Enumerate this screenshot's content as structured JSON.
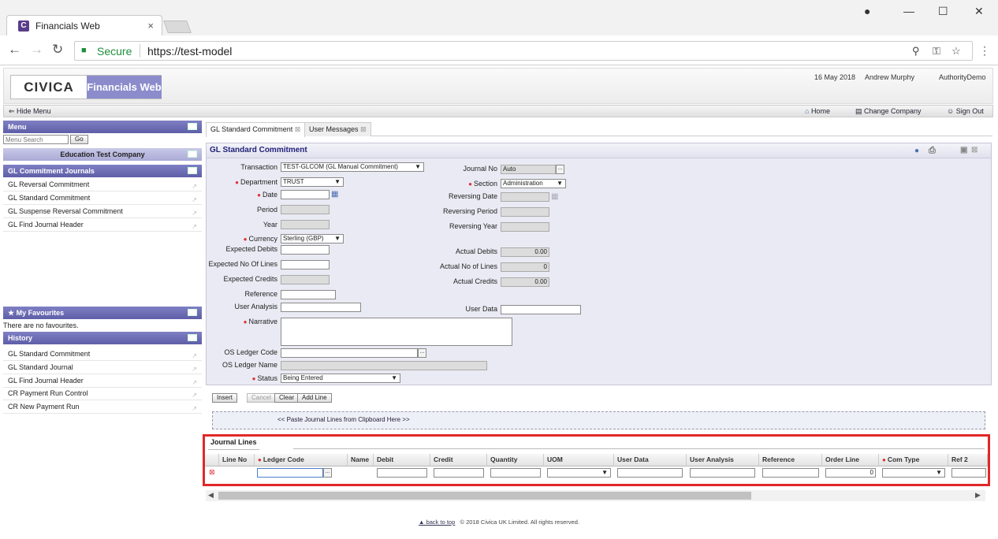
{
  "browser": {
    "tab_title": "Financials Web",
    "tab_close": "×",
    "secure": "Secure",
    "url": "https://test-model"
  },
  "header": {
    "brand": "CIVICA",
    "app_name": "Financials Web",
    "date": "16 May 2018",
    "user": "Andrew Murphy",
    "org": "AuthorityDemo"
  },
  "menubar": {
    "hide_menu": "Hide Menu",
    "home": "Home",
    "change_company": "Change Company",
    "sign_out": "Sign Out"
  },
  "sidebar": {
    "menu_title": "Menu",
    "search_placeholder": "Menu Search",
    "go": "Go",
    "company": "Education Test Company",
    "section_title": "GL Commitment Journals",
    "items": [
      {
        "label": "GL Reversal Commitment"
      },
      {
        "label": "GL Standard Commitment"
      },
      {
        "label": "GL Suspense Reversal Commitment"
      },
      {
        "label": "GL Find Journal Header"
      }
    ],
    "favourites_title": "My Favourites",
    "favourites_empty": "There are no favourites.",
    "history_title": "History",
    "history": [
      {
        "label": "GL Standard Commitment"
      },
      {
        "label": "GL Standard Journal"
      },
      {
        "label": "GL Find Journal Header"
      },
      {
        "label": "CR Payment Run Control"
      },
      {
        "label": "CR New Payment Run"
      }
    ]
  },
  "tabs": [
    {
      "label": "GL Standard Commitment"
    },
    {
      "label": "User Messages"
    }
  ],
  "form": {
    "title": "GL Standard Commitment",
    "transaction_label": "Transaction",
    "transaction_value": "TEST-GLCOM (GL Manual Commitment)",
    "department_label": "Department",
    "department_value": "TRUST",
    "date_label": "Date",
    "period_label": "Period",
    "year_label": "Year",
    "currency_label": "Currency",
    "currency_value": "Sterling (GBP)",
    "expected_debits_label": "Expected Debits",
    "expected_lines_label": "Expected No Of Lines",
    "expected_credits_label": "Expected Credits",
    "reference_label": "Reference",
    "user_analysis_label": "User Analysis",
    "narrative_label": "Narrative",
    "os_code_label": "OS Ledger Code",
    "os_name_label": "OS Ledger Name",
    "status_label": "Status",
    "status_value": "Being Entered",
    "journal_no_label": "Journal No",
    "journal_no_value": "Auto",
    "section_label": "Section",
    "section_value": "Administration",
    "rev_date_label": "Reversing Date",
    "rev_period_label": "Reversing Period",
    "rev_year_label": "Reversing Year",
    "actual_debits_label": "Actual Debits",
    "actual_debits_value": "0.00",
    "actual_lines_label": "Actual No of Lines",
    "actual_lines_value": "0",
    "actual_credits_label": "Actual Credits",
    "actual_credits_value": "0.00",
    "user_data_label": "User Data",
    "ellipsis": "..."
  },
  "buttons": {
    "insert": "Insert",
    "cancel": "Cancel",
    "clear": "Clear",
    "add_line": "Add Line"
  },
  "paste_text": "<< Paste Journal Lines from Clipboard Here >>",
  "journal_lines": {
    "title": "Journal Lines",
    "columns": [
      "Line No",
      "Ledger Code",
      "Name",
      "Debit",
      "Credit",
      "Quantity",
      "UOM",
      "User Data",
      "User Analysis",
      "Reference",
      "Order Line",
      "Com Type",
      "Ref 2"
    ],
    "row": {
      "order_line": "0"
    }
  },
  "footer": {
    "back_to_top": "back to top",
    "copyright": "© 2018 Civica UK Limited. All rights reserved."
  },
  "colors": {
    "accent": "#6b6bb5",
    "highlight": "#e0282a"
  }
}
